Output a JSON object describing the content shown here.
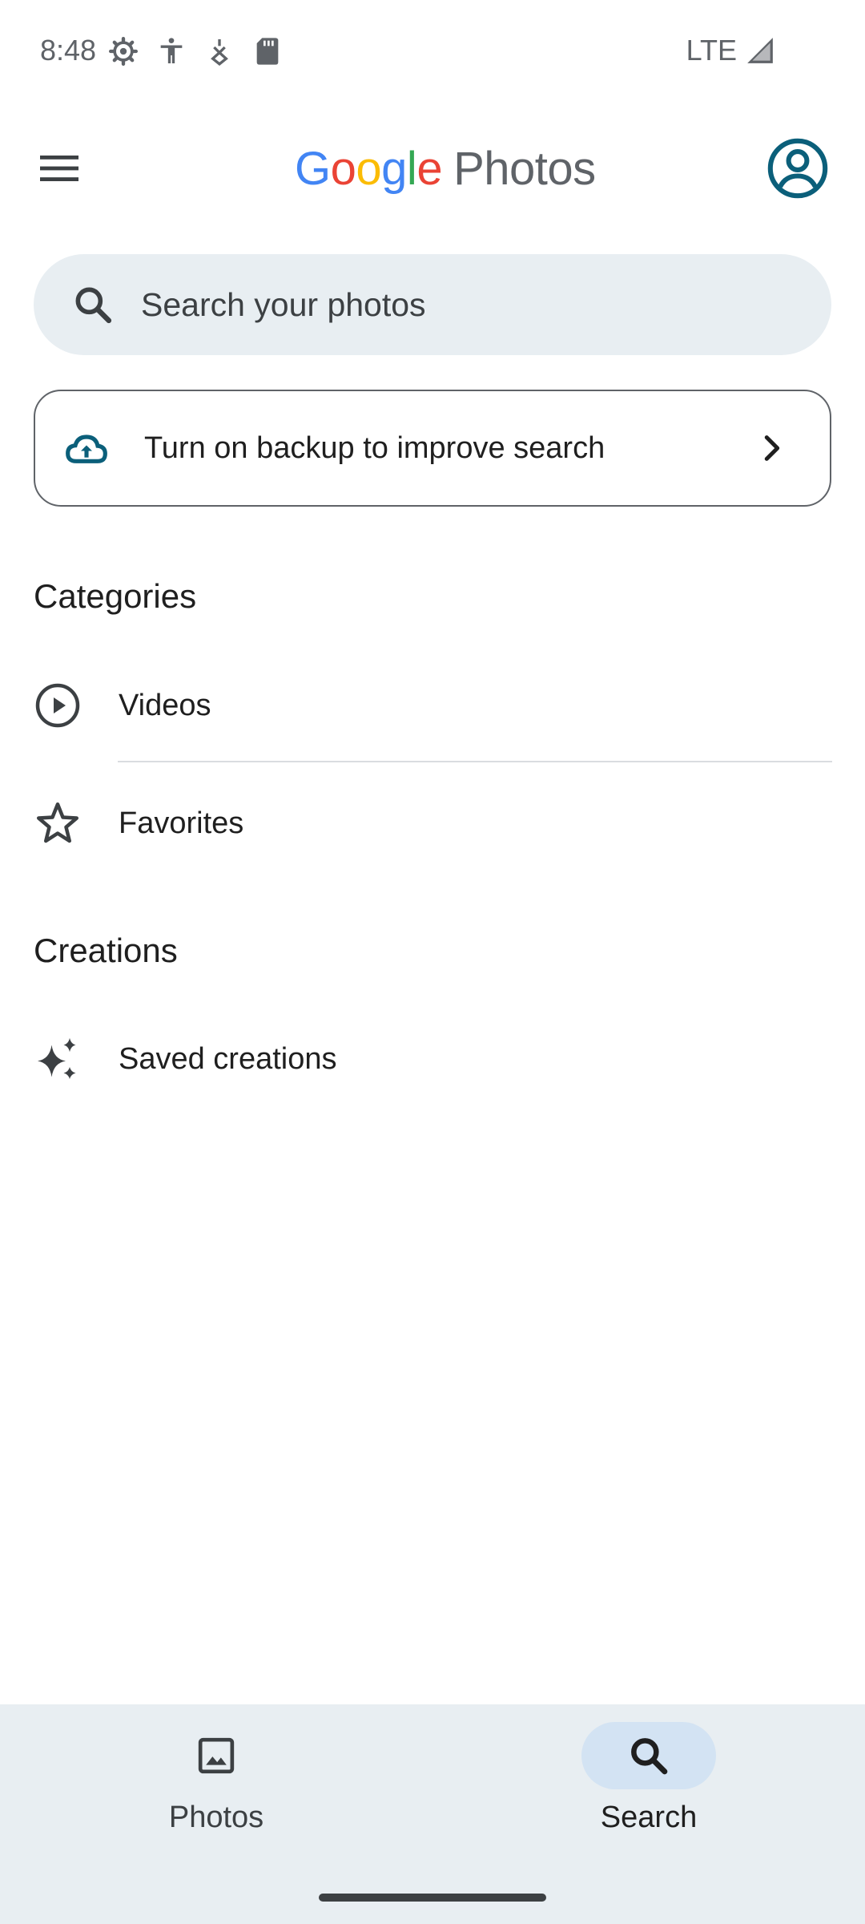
{
  "status_bar": {
    "time": "8:48",
    "network": "LTE",
    "icons": [
      "settings-gear-icon",
      "accessibility-icon",
      "vpn-key-icon",
      "sd-card-icon",
      "signal-icon"
    ]
  },
  "app_bar": {
    "logo": {
      "google_letters": [
        {
          "char": "G",
          "color": "#4285F4"
        },
        {
          "char": "o",
          "color": "#EA4335"
        },
        {
          "char": "o",
          "color": "#FBBC05"
        },
        {
          "char": "g",
          "color": "#4285F4"
        },
        {
          "char": "l",
          "color": "#34A853"
        },
        {
          "char": "e",
          "color": "#EA4335"
        }
      ],
      "product": "Photos"
    },
    "menu_icon": "hamburger-menu-icon",
    "account_icon": "account-circle-icon",
    "accent_color": "#0b5f7a"
  },
  "search": {
    "placeholder": "Search your photos"
  },
  "backup_card": {
    "label": "Turn on backup to improve search",
    "icon": "cloud-upload-icon"
  },
  "sections": {
    "categories": {
      "title": "Categories",
      "items": [
        {
          "label": "Videos",
          "icon": "play-circle-icon"
        },
        {
          "label": "Favorites",
          "icon": "star-outline-icon"
        }
      ]
    },
    "creations": {
      "title": "Creations",
      "items": [
        {
          "label": "Saved creations",
          "icon": "sparkle-icon"
        }
      ]
    }
  },
  "bottom_nav": {
    "tabs": [
      {
        "label": "Photos",
        "icon": "photo-icon",
        "active": false
      },
      {
        "label": "Search",
        "icon": "search-icon",
        "active": true
      }
    ]
  }
}
